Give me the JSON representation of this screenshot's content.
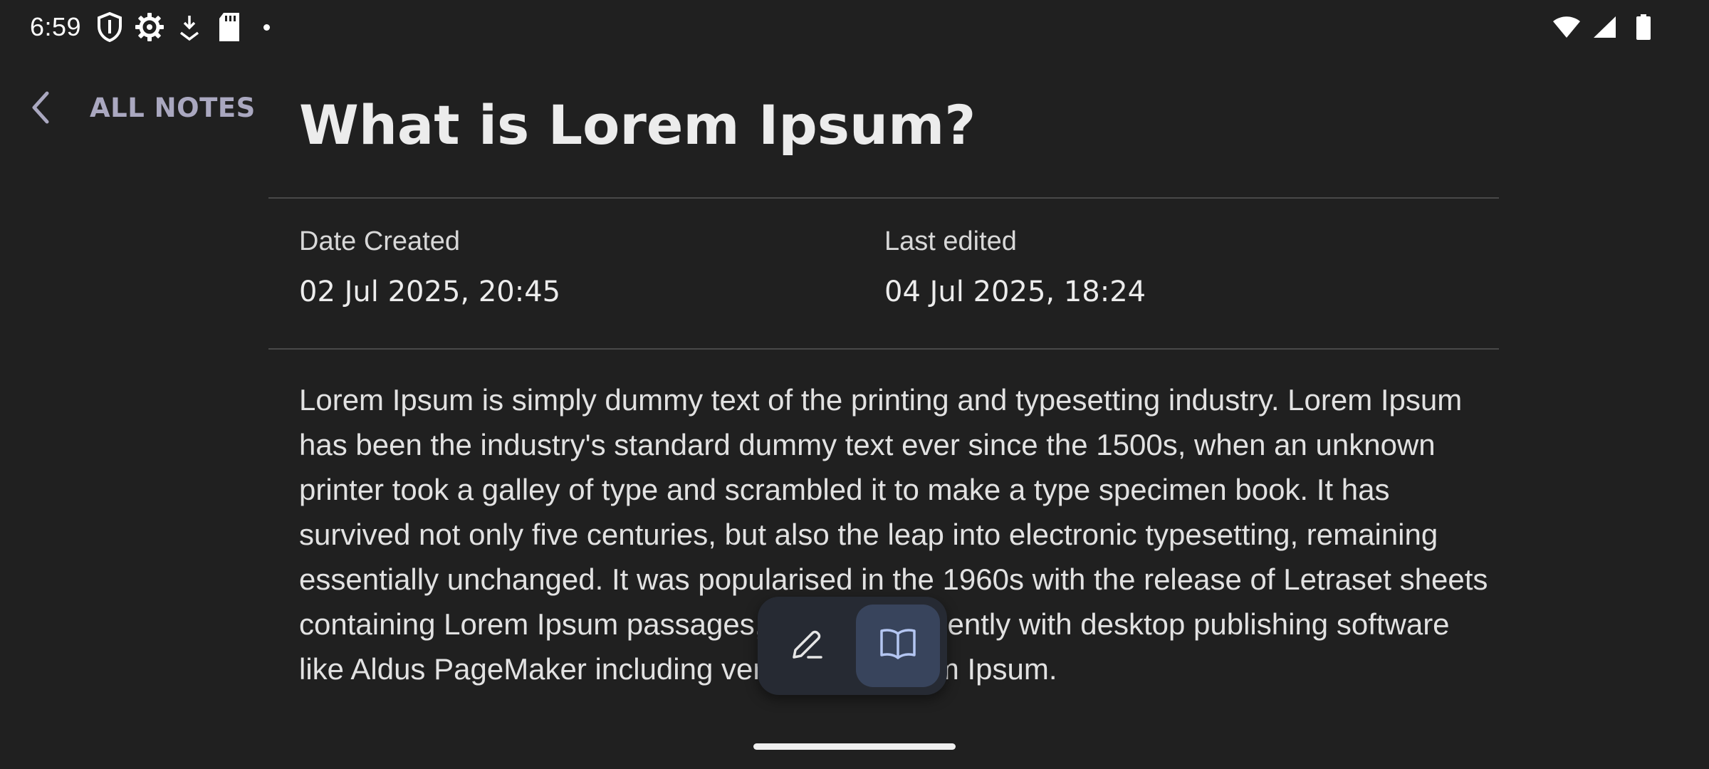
{
  "status_bar": {
    "time": "6:59",
    "left_icons": [
      "shield-icon",
      "gear-icon",
      "download-icon",
      "sd-card-icon",
      "notification-dot"
    ],
    "right_icons": [
      "wifi-icon",
      "cellular-signal-icon",
      "battery-icon"
    ]
  },
  "nav": {
    "back_label": "ALL NOTES",
    "back_icon": "chevron-left-icon"
  },
  "note": {
    "title": "What is Lorem Ipsum?",
    "date_created_label": "Date Created",
    "date_created_value": "02 Jul 2025, 20:45",
    "last_edited_label": "Last edited",
    "last_edited_value": "04 Jul 2025, 18:24",
    "body": "Lorem Ipsum is simply dummy text of the printing and typesetting industry. Lorem Ipsum has been the industry's standard dummy text ever since the 1500s, when an unknown printer took a galley of type and scrambled it to make a type specimen book. It has survived not only five centuries, but also the leap into electronic typesetting, remaining essentially unchanged. It was popularised in the 1960s with the release of Letraset sheets containing Lorem Ipsum passages, and more recently with desktop publishing software like Aldus PageMaker including versions of Lorem Ipsum."
  },
  "mode_toolbar": {
    "buttons": [
      {
        "name": "edit-mode-button",
        "icon": "pencil-icon",
        "active": false
      },
      {
        "name": "read-mode-button",
        "icon": "book-open-icon",
        "active": true
      }
    ]
  },
  "colors": {
    "background": "#202020",
    "accent": "#aaa8c0",
    "active_mode": "#38445c",
    "toolbar": "#262a33",
    "icon_active": "#b4c6f2"
  }
}
